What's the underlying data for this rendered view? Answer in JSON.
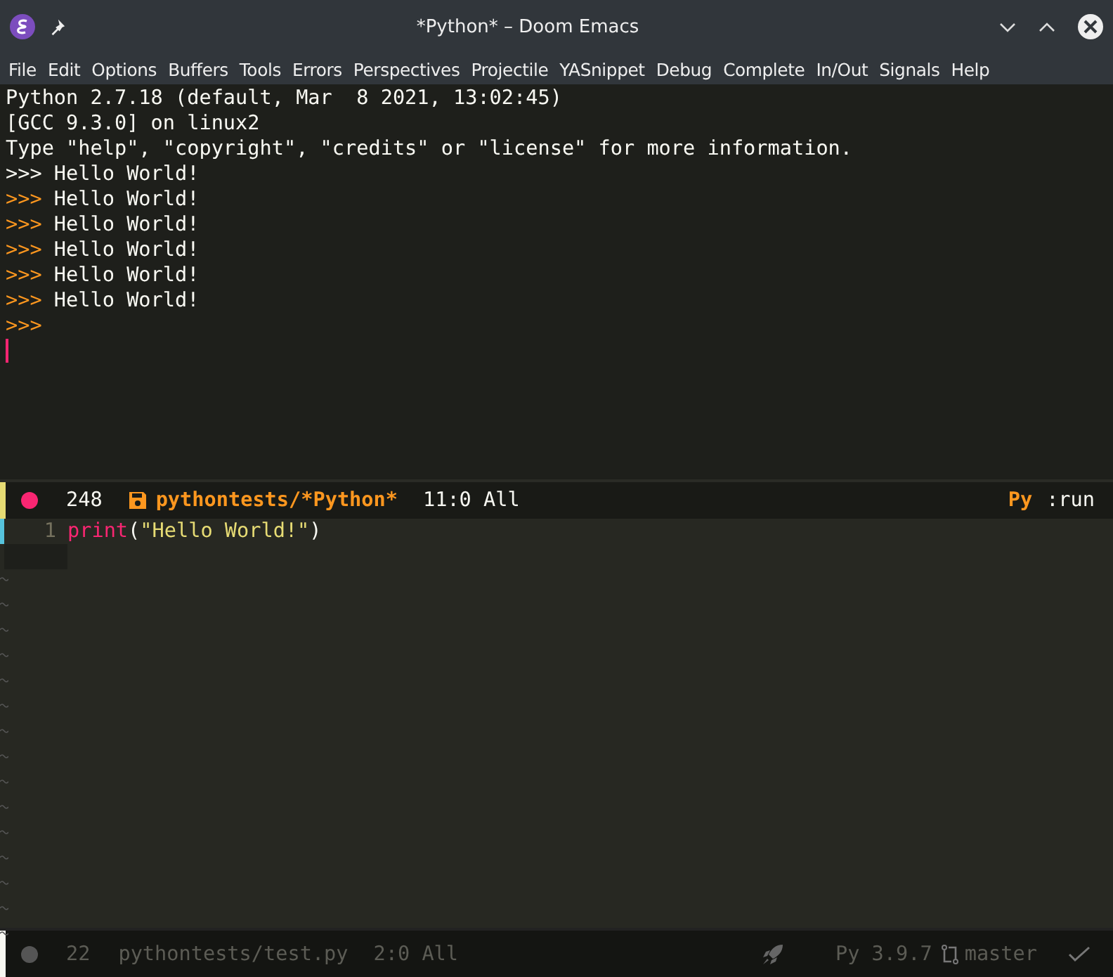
{
  "window": {
    "title": "*Python* – Doom Emacs"
  },
  "menu": [
    "File",
    "Edit",
    "Options",
    "Buffers",
    "Tools",
    "Errors",
    "Perspectives",
    "Projectile",
    "YASnippet",
    "Debug",
    "Complete",
    "In/Out",
    "Signals",
    "Help"
  ],
  "repl": {
    "lines": [
      {
        "kind": "text",
        "text": "Python 2.7.18 (default, Mar  8 2021, 13:02:45)"
      },
      {
        "kind": "text",
        "text": "[GCC 9.3.0] on linux2"
      },
      {
        "kind": "text",
        "text": "Type \"help\", \"copyright\", \"credits\" or \"license\" for more information."
      },
      {
        "kind": "prompt",
        "prompt": ">>>",
        "highlighted": false,
        "text": "Hello World!"
      },
      {
        "kind": "prompt",
        "prompt": ">>>",
        "highlighted": true,
        "text": "Hello World!"
      },
      {
        "kind": "prompt",
        "prompt": ">>>",
        "highlighted": true,
        "text": "Hello World!"
      },
      {
        "kind": "prompt",
        "prompt": ">>>",
        "highlighted": true,
        "text": "Hello World!"
      },
      {
        "kind": "prompt",
        "prompt": ">>>",
        "highlighted": true,
        "text": "Hello World!"
      },
      {
        "kind": "prompt",
        "prompt": ">>>",
        "highlighted": true,
        "text": "Hello World!"
      },
      {
        "kind": "prompt",
        "prompt": ">>>",
        "highlighted": true
      },
      {
        "kind": "cursor"
      }
    ]
  },
  "modeline_top": {
    "active": true,
    "modified": true,
    "size": "248",
    "buffer": "pythontests/*Python*",
    "position": "11:0 All",
    "mode": "Py",
    "process": ":run"
  },
  "editor": {
    "lines": [
      {
        "number": "1",
        "tokens": [
          {
            "kind": "builtin",
            "text": "print"
          },
          {
            "kind": "paren",
            "text": "("
          },
          {
            "kind": "string",
            "text": "\"Hello World!\""
          },
          {
            "kind": "paren",
            "text": ")"
          }
        ]
      }
    ]
  },
  "modeline_bottom": {
    "active": false,
    "modified": false,
    "size": "22",
    "buffer": "pythontests/test.py",
    "position": "2:0 All",
    "version": "Py 3.9.7",
    "branch": "master"
  }
}
